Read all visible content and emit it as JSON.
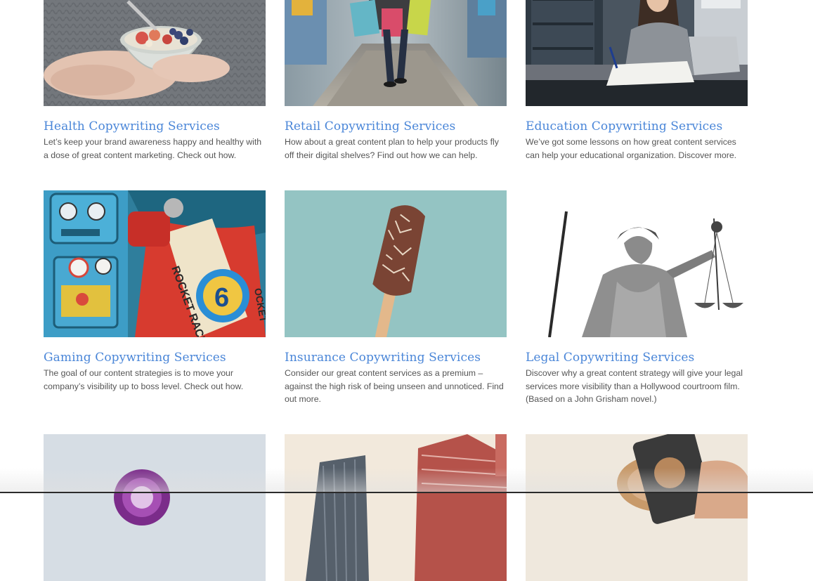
{
  "cards": [
    {
      "title": "Health Copywriting Services",
      "description": "Let’s keep your brand awareness happy and healthy with a dose of great content marketing. Check out how.",
      "image": "health-bowl-image"
    },
    {
      "title": "Retail Copywriting Services",
      "description": "How about a great content plan to help your products fly off their digital shelves? Find out how we can help.",
      "image": "retail-shopping-image"
    },
    {
      "title": "Education Copywriting Services",
      "description": "We’ve got some lessons on how great content services can help your educational organization. Discover more.",
      "image": "education-student-image"
    },
    {
      "title": "Gaming Copywriting Services",
      "description": "The goal of our content strategies is to move your company’s visibility up to boss level. Check out how.",
      "image": "gaming-toys-image",
      "image_text": {
        "rocket": "ROCKET RACER",
        "number": "6",
        "side": "OCKET"
      }
    },
    {
      "title": "Insurance Copywriting Services",
      "description": "Consider our great content services as a premium – against the high risk of being unseen and unnoticed. Find out more.",
      "image": "insurance-icecream-image"
    },
    {
      "title": "Legal Copywriting Services",
      "description": "Discover why a great content strategy will give your legal services more visibility than a Hollywood courtroom film. (Based on a John Grisham novel.)",
      "image": "legal-justice-statue-image"
    }
  ],
  "partial_cards": [
    {
      "image": "purple-drink-image"
    },
    {
      "image": "buildings-image"
    },
    {
      "image": "phone-photo-image"
    }
  ],
  "colors": {
    "title": "#4a86d8",
    "text": "#555555",
    "background": "#ffffff"
  }
}
